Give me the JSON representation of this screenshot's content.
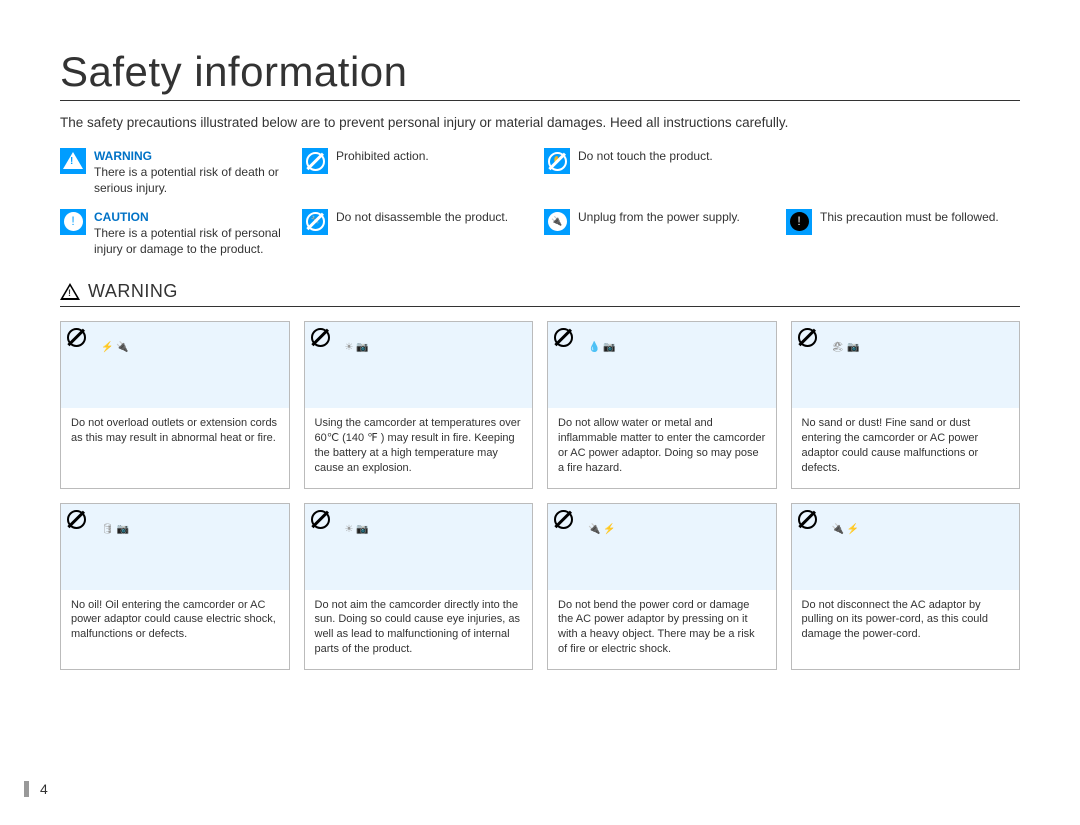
{
  "title": "Safety information",
  "intro": "The safety precautions illustrated below are to prevent personal injury or material damages. Heed all instructions carefully.",
  "legend": {
    "warning": {
      "label": "WARNING",
      "text": "There is a potential risk of death or serious injury."
    },
    "caution": {
      "label": "CAUTION",
      "text": "There is a potential risk of personal injury or damage to the product."
    },
    "prohibited": "Prohibited action.",
    "no_disassemble": "Do not disassemble the product.",
    "no_touch": "Do not touch the product.",
    "unplug": "Unplug from the power supply.",
    "must_follow": "This precaution must be followed."
  },
  "section_heading": "WARNING",
  "cards_row1": [
    {
      "text": "Do not overload outlets or extension cords as this may result in abnormal heat or fire."
    },
    {
      "text": "Using the camcorder at temperatures over 60℃ (140 ℉ ) may result in fire. Keeping the battery at a high temperature may cause an explosion."
    },
    {
      "text": "Do not allow water or metal and inflammable matter to enter the camcorder or AC power adaptor. Doing so may pose a fire hazard."
    },
    {
      "text": "No sand or dust! Fine sand or dust entering the camcorder or AC power adaptor could cause malfunctions or defects."
    }
  ],
  "cards_row2": [
    {
      "text": "No oil! Oil entering the camcorder or AC power adaptor could cause electric shock, malfunctions or defects."
    },
    {
      "text": "Do not aim the camcorder directly into the sun. Doing so could cause eye injuries, as well as lead to malfunctioning of internal parts of the product."
    },
    {
      "text": "Do not bend the power cord or damage the AC power adaptor by pressing on it with a heavy object. There may be a risk of fire or electric shock."
    },
    {
      "text": "Do not disconnect the AC adaptor by pulling on its power-cord, as this could damage the power-cord."
    }
  ],
  "page_number": "4"
}
